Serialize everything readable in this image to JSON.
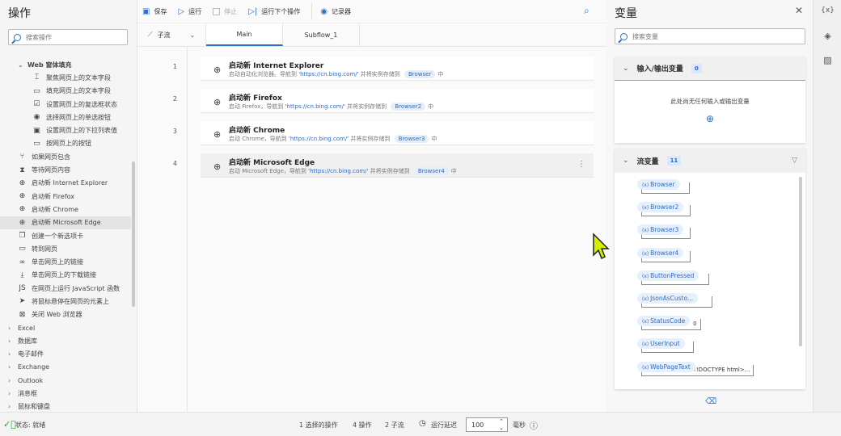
{
  "left": {
    "title": "操作",
    "search_placeholder": "搜索操作",
    "items": [
      {
        "label": "Web 窗体填充",
        "level": 1,
        "icon": "chevron-down",
        "kind": "group"
      },
      {
        "label": "聚焦网页上的文本字段",
        "level": 2,
        "icon": "text-field-focus"
      },
      {
        "label": "填充网页上的文本字段",
        "level": 2,
        "icon": "text-field"
      },
      {
        "label": "设置网页上的复选框状态",
        "level": 2,
        "icon": "checkbox"
      },
      {
        "label": "选择网页上的单选按钮",
        "level": 2,
        "icon": "radio"
      },
      {
        "label": "设置网页上的下拉列表值",
        "level": 2,
        "icon": "dropdown"
      },
      {
        "label": "按网页上的按钮",
        "level": 2,
        "icon": "button"
      },
      {
        "label": "如果网页包含",
        "level": 1,
        "icon": "branch"
      },
      {
        "label": "等待网页内容",
        "level": 1,
        "icon": "hourglass"
      },
      {
        "label": "启动新 Internet Explorer",
        "level": 1,
        "icon": "globe"
      },
      {
        "label": "启动新 Firefox",
        "level": 1,
        "icon": "globe"
      },
      {
        "label": "启动新 Chrome",
        "level": 1,
        "icon": "globe"
      },
      {
        "label": "启动新 Microsoft Edge",
        "level": 1,
        "icon": "globe",
        "selected": true
      },
      {
        "label": "创建一个新选项卡",
        "level": 1,
        "icon": "new-tab"
      },
      {
        "label": "转到网页",
        "level": 1,
        "icon": "window"
      },
      {
        "label": "单击网页上的链接",
        "level": 1,
        "icon": "link"
      },
      {
        "label": "单击网页上的下载链接",
        "level": 1,
        "icon": "download"
      },
      {
        "label": "在网页上运行 JavaScript 函数",
        "level": 1,
        "icon": "js"
      },
      {
        "label": "将鼠标悬停在网页的元素上",
        "level": 1,
        "icon": "pointer"
      },
      {
        "label": "关闭 Web 浏览器",
        "level": 1,
        "icon": "close-box"
      },
      {
        "label": "Excel",
        "level": 0,
        "kind": "group"
      },
      {
        "label": "数据库",
        "level": 0,
        "kind": "group"
      },
      {
        "label": "电子邮件",
        "level": 0,
        "kind": "group"
      },
      {
        "label": "Exchange",
        "level": 0,
        "kind": "group"
      },
      {
        "label": "Outlook",
        "level": 0,
        "kind": "group"
      },
      {
        "label": "消息框",
        "level": 0,
        "kind": "group"
      },
      {
        "label": "鼠标和键盘",
        "level": 0,
        "kind": "group"
      }
    ]
  },
  "toolbar": {
    "save": "保存",
    "run": "运行",
    "stop": "停止",
    "run_next": "运行下个操作",
    "recorder": "记录器"
  },
  "tabs": {
    "subflow": "子流",
    "main": "Main",
    "subflow1": "Subflow_1"
  },
  "actions": [
    {
      "num": "1",
      "title": "启动新 Internet Explorer",
      "pre": "启动自动化浏览器。导航到 ",
      "url": "'https://cn.bing.com/'",
      "mid": " 并将实例存储到 ",
      "var": "Browser",
      "post": "中"
    },
    {
      "num": "2",
      "title": "启动新 Firefox",
      "pre": "启动 Firefox，导航到 ",
      "url": "'https://cn.bing.com/'",
      "mid": " 并将实例存储到 ",
      "var": "Browser2",
      "post": "中"
    },
    {
      "num": "3",
      "title": "启动新 Chrome",
      "pre": "启动 Chrome，导航到 ",
      "url": "'https://cn.bing.com/'",
      "mid": " 并将实例存储到 ",
      "var": "Browser3",
      "post": "中"
    },
    {
      "num": "4",
      "title": "启动新 Microsoft Edge",
      "pre": "启动 Microsoft Edge，导航到 ",
      "url": "'https://cn.bing.com/'",
      "mid": " 并将实例存储到 ",
      "var": "Browser4",
      "post": "中",
      "selected": true
    }
  ],
  "variables": {
    "title": "变量",
    "search_placeholder": "搜索变量",
    "io": {
      "label": "输入/输出变量",
      "count": "0",
      "empty": "此处尚无任何输入或输出变量"
    },
    "flow": {
      "label": "流变量",
      "count": "11",
      "items": [
        {
          "name": "Browser",
          "value": ""
        },
        {
          "name": "Browser2",
          "value": ""
        },
        {
          "name": "Browser3",
          "value": ""
        },
        {
          "name": "Browser4",
          "value": ""
        },
        {
          "name": "ButtonPressed",
          "value": ""
        },
        {
          "name": "JsonAsCusto...",
          "value": ""
        },
        {
          "name": "StatusCode",
          "value": "0"
        },
        {
          "name": "UserInput",
          "value": ""
        },
        {
          "name": "WebPageText",
          "value": "<!DOCTYPE html>..."
        }
      ]
    }
  },
  "rail": {
    "vars": "{x}"
  },
  "status": {
    "state": "状态: 就绪",
    "selected": "1 选择的操作",
    "actions": "4 操作",
    "subflows": "2 子流",
    "delay_label": "运行延迟",
    "delay_value": "100",
    "unit": "毫秒"
  }
}
